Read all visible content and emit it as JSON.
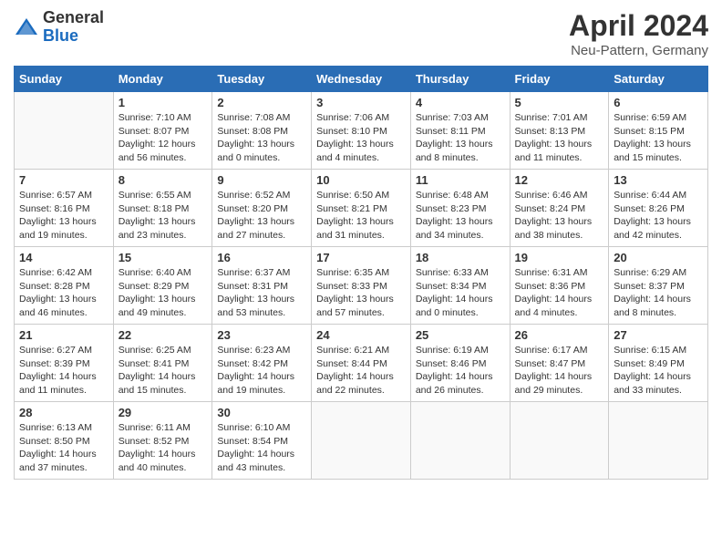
{
  "header": {
    "logo_line1": "General",
    "logo_line2": "Blue",
    "title": "April 2024",
    "subtitle": "Neu-Pattern, Germany"
  },
  "calendar": {
    "weekdays": [
      "Sunday",
      "Monday",
      "Tuesday",
      "Wednesday",
      "Thursday",
      "Friday",
      "Saturday"
    ],
    "weeks": [
      [
        {
          "day": "",
          "info": ""
        },
        {
          "day": "1",
          "info": "Sunrise: 7:10 AM\nSunset: 8:07 PM\nDaylight: 12 hours\nand 56 minutes."
        },
        {
          "day": "2",
          "info": "Sunrise: 7:08 AM\nSunset: 8:08 PM\nDaylight: 13 hours\nand 0 minutes."
        },
        {
          "day": "3",
          "info": "Sunrise: 7:06 AM\nSunset: 8:10 PM\nDaylight: 13 hours\nand 4 minutes."
        },
        {
          "day": "4",
          "info": "Sunrise: 7:03 AM\nSunset: 8:11 PM\nDaylight: 13 hours\nand 8 minutes."
        },
        {
          "day": "5",
          "info": "Sunrise: 7:01 AM\nSunset: 8:13 PM\nDaylight: 13 hours\nand 11 minutes."
        },
        {
          "day": "6",
          "info": "Sunrise: 6:59 AM\nSunset: 8:15 PM\nDaylight: 13 hours\nand 15 minutes."
        }
      ],
      [
        {
          "day": "7",
          "info": "Sunrise: 6:57 AM\nSunset: 8:16 PM\nDaylight: 13 hours\nand 19 minutes."
        },
        {
          "day": "8",
          "info": "Sunrise: 6:55 AM\nSunset: 8:18 PM\nDaylight: 13 hours\nand 23 minutes."
        },
        {
          "day": "9",
          "info": "Sunrise: 6:52 AM\nSunset: 8:20 PM\nDaylight: 13 hours\nand 27 minutes."
        },
        {
          "day": "10",
          "info": "Sunrise: 6:50 AM\nSunset: 8:21 PM\nDaylight: 13 hours\nand 31 minutes."
        },
        {
          "day": "11",
          "info": "Sunrise: 6:48 AM\nSunset: 8:23 PM\nDaylight: 13 hours\nand 34 minutes."
        },
        {
          "day": "12",
          "info": "Sunrise: 6:46 AM\nSunset: 8:24 PM\nDaylight: 13 hours\nand 38 minutes."
        },
        {
          "day": "13",
          "info": "Sunrise: 6:44 AM\nSunset: 8:26 PM\nDaylight: 13 hours\nand 42 minutes."
        }
      ],
      [
        {
          "day": "14",
          "info": "Sunrise: 6:42 AM\nSunset: 8:28 PM\nDaylight: 13 hours\nand 46 minutes."
        },
        {
          "day": "15",
          "info": "Sunrise: 6:40 AM\nSunset: 8:29 PM\nDaylight: 13 hours\nand 49 minutes."
        },
        {
          "day": "16",
          "info": "Sunrise: 6:37 AM\nSunset: 8:31 PM\nDaylight: 13 hours\nand 53 minutes."
        },
        {
          "day": "17",
          "info": "Sunrise: 6:35 AM\nSunset: 8:33 PM\nDaylight: 13 hours\nand 57 minutes."
        },
        {
          "day": "18",
          "info": "Sunrise: 6:33 AM\nSunset: 8:34 PM\nDaylight: 14 hours\nand 0 minutes."
        },
        {
          "day": "19",
          "info": "Sunrise: 6:31 AM\nSunset: 8:36 PM\nDaylight: 14 hours\nand 4 minutes."
        },
        {
          "day": "20",
          "info": "Sunrise: 6:29 AM\nSunset: 8:37 PM\nDaylight: 14 hours\nand 8 minutes."
        }
      ],
      [
        {
          "day": "21",
          "info": "Sunrise: 6:27 AM\nSunset: 8:39 PM\nDaylight: 14 hours\nand 11 minutes."
        },
        {
          "day": "22",
          "info": "Sunrise: 6:25 AM\nSunset: 8:41 PM\nDaylight: 14 hours\nand 15 minutes."
        },
        {
          "day": "23",
          "info": "Sunrise: 6:23 AM\nSunset: 8:42 PM\nDaylight: 14 hours\nand 19 minutes."
        },
        {
          "day": "24",
          "info": "Sunrise: 6:21 AM\nSunset: 8:44 PM\nDaylight: 14 hours\nand 22 minutes."
        },
        {
          "day": "25",
          "info": "Sunrise: 6:19 AM\nSunset: 8:46 PM\nDaylight: 14 hours\nand 26 minutes."
        },
        {
          "day": "26",
          "info": "Sunrise: 6:17 AM\nSunset: 8:47 PM\nDaylight: 14 hours\nand 29 minutes."
        },
        {
          "day": "27",
          "info": "Sunrise: 6:15 AM\nSunset: 8:49 PM\nDaylight: 14 hours\nand 33 minutes."
        }
      ],
      [
        {
          "day": "28",
          "info": "Sunrise: 6:13 AM\nSunset: 8:50 PM\nDaylight: 14 hours\nand 37 minutes."
        },
        {
          "day": "29",
          "info": "Sunrise: 6:11 AM\nSunset: 8:52 PM\nDaylight: 14 hours\nand 40 minutes."
        },
        {
          "day": "30",
          "info": "Sunrise: 6:10 AM\nSunset: 8:54 PM\nDaylight: 14 hours\nand 43 minutes."
        },
        {
          "day": "",
          "info": ""
        },
        {
          "day": "",
          "info": ""
        },
        {
          "day": "",
          "info": ""
        },
        {
          "day": "",
          "info": ""
        }
      ]
    ]
  }
}
